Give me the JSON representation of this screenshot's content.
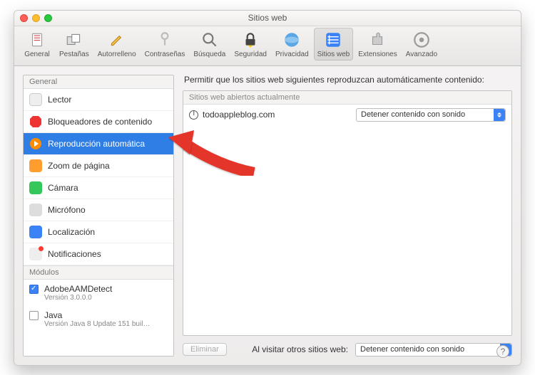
{
  "window": {
    "title": "Sitios web"
  },
  "toolbar": [
    {
      "label": "General"
    },
    {
      "label": "Pestañas"
    },
    {
      "label": "Autorrelleno"
    },
    {
      "label": "Contraseñas"
    },
    {
      "label": "Búsqueda"
    },
    {
      "label": "Seguridad"
    },
    {
      "label": "Privacidad"
    },
    {
      "label": "Sitios web"
    },
    {
      "label": "Extensiones"
    },
    {
      "label": "Avanzado"
    }
  ],
  "sidebar": {
    "section_general": "General",
    "general_items": [
      {
        "label": "Lector"
      },
      {
        "label": "Bloqueadores de contenido"
      },
      {
        "label": "Reproducción automática"
      },
      {
        "label": "Zoom de página"
      },
      {
        "label": "Cámara"
      },
      {
        "label": "Micrófono"
      },
      {
        "label": "Localización"
      },
      {
        "label": "Notificaciones"
      }
    ],
    "section_modules": "Módulos",
    "modules": [
      {
        "name": "AdobeAAMDetect",
        "version": "Versión 3.0.0.0",
        "checked": true
      },
      {
        "name": "Java",
        "version": "Versión Java 8 Update 151 buil…",
        "checked": false
      }
    ]
  },
  "main": {
    "heading": "Permitir que los sitios web siguientes reproduzcan automáticamente contenido:",
    "list_header": "Sitios web abiertos actualmente",
    "rows": [
      {
        "site": "todoappleblog.com",
        "option": "Detener contenido con sonido"
      }
    ],
    "delete_label": "Eliminar",
    "footer_label": "Al visitar otros sitios web:",
    "footer_option": "Detener contenido con sonido"
  }
}
